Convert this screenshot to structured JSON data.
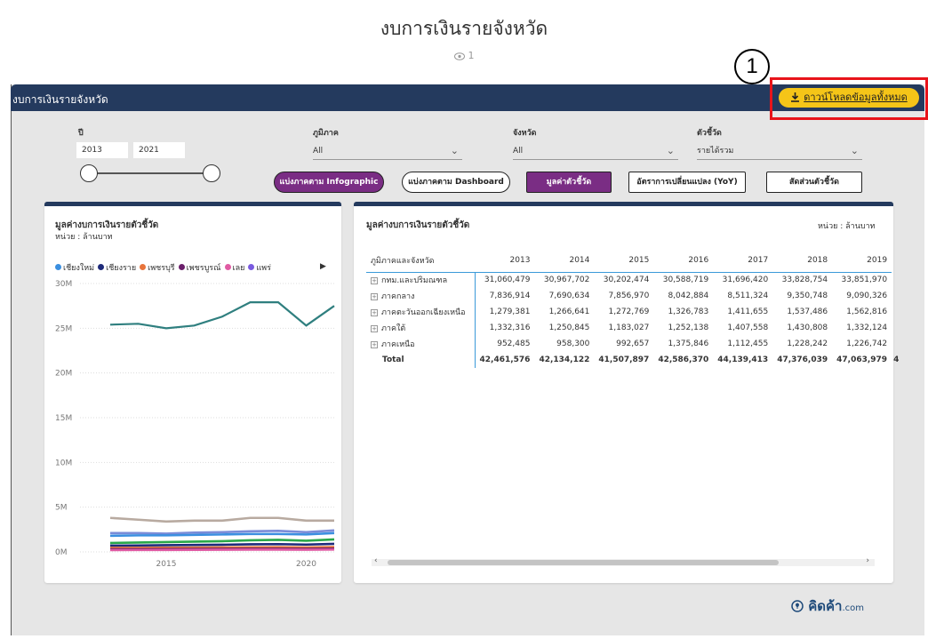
{
  "page": {
    "title": "งบการเงินรายจังหวัด",
    "views": "1"
  },
  "panel": {
    "title": "งบการเงินรายจังหวัด",
    "download_label": "ดาวน์โหลดข้อมูลทั้งหมด",
    "marker": "1"
  },
  "filters": {
    "year_label": "ปี",
    "year_from": "2013",
    "year_to": "2021",
    "region_label": "ภูมิภาค",
    "region_value": "All",
    "province_label": "จังหวัด",
    "province_value": "All",
    "indicator_label": "ตัวชี้วัด",
    "indicator_value": "รายได้รวม"
  },
  "buttons": {
    "infographic": "แบ่งภาคตาม Infographic",
    "dashboard": "แบ่งภาคตาม Dashboard",
    "indicator_value": "มูลค่าตัวชี้วัด",
    "yoy": "อัตราการเปลี่ยนแปลง (YoY)",
    "share": "สัดส่วนตัวชี้วัด"
  },
  "left_card": {
    "title": "มูลค่างบการเงินรายตัวชี้วัด",
    "unit": "หน่วย : ล้านบาท",
    "legend": [
      {
        "name": "เชียงใหม่",
        "color": "#3b8fe0"
      },
      {
        "name": "เชียงราย",
        "color": "#1e2a7a"
      },
      {
        "name": "เพชรบุรี",
        "color": "#e8743b"
      },
      {
        "name": "เพชรบูรณ์",
        "color": "#6b1f6b"
      },
      {
        "name": "เลย",
        "color": "#e05ba3"
      },
      {
        "name": "แพร่",
        "color": "#7a5be0"
      }
    ]
  },
  "right_card": {
    "title": "มูลค่างบการเงินรายตัวชี้วัด",
    "unit": "หน่วย : ล้านบาท",
    "row_header": "ภูมิภาคและจังหวัด",
    "years": [
      "2013",
      "2014",
      "2015",
      "2016",
      "2017",
      "2018",
      "2019"
    ],
    "rows": [
      {
        "label": "กทม.และปริมณฑล",
        "values": [
          "31,060,479",
          "30,967,702",
          "30,202,474",
          "30,588,719",
          "31,696,420",
          "33,828,754",
          "33,851,970"
        ]
      },
      {
        "label": "ภาคกลาง",
        "values": [
          "7,836,914",
          "7,690,634",
          "7,856,970",
          "8,042,884",
          "8,511,324",
          "9,350,748",
          "9,090,326"
        ]
      },
      {
        "label": "ภาคตะวันออกเฉียงเหนือ",
        "values": [
          "1,279,381",
          "1,266,641",
          "1,272,769",
          "1,326,783",
          "1,411,655",
          "1,537,486",
          "1,562,816"
        ]
      },
      {
        "label": "ภาคใต้",
        "values": [
          "1,332,316",
          "1,250,845",
          "1,183,027",
          "1,252,138",
          "1,407,558",
          "1,430,808",
          "1,332,124"
        ]
      },
      {
        "label": "ภาคเหนือ",
        "values": [
          "952,485",
          "958,300",
          "992,657",
          "1,375,846",
          "1,112,455",
          "1,228,242",
          "1,226,742"
        ]
      }
    ],
    "total": {
      "label": "Total",
      "values": [
        "42,461,576",
        "42,134,122",
        "41,507,897",
        "42,586,370",
        "44,139,413",
        "47,376,039",
        "47,063,979"
      ],
      "overflow": "4"
    }
  },
  "chart_data": {
    "type": "line",
    "x": [
      2013,
      2014,
      2015,
      2016,
      2017,
      2018,
      2019,
      2020,
      2021
    ],
    "xticks": [
      "2015",
      "2020"
    ],
    "yticks": [
      "30M",
      "25M",
      "20M",
      "15M",
      "10M",
      "5M",
      "0M"
    ],
    "ylim": [
      0,
      30000000
    ],
    "xlim": [
      2013,
      2021
    ],
    "series": [
      {
        "color": "#2f7f7f",
        "values": [
          25400000,
          25500000,
          25000000,
          25300000,
          26300000,
          27900000,
          27900000,
          25300000,
          27500000
        ]
      },
      {
        "color": "#b8aaa0",
        "values": [
          3800000,
          3600000,
          3400000,
          3500000,
          3500000,
          3800000,
          3800000,
          3500000,
          3500000
        ]
      },
      {
        "color": "#7a8cd8",
        "values": [
          2100000,
          2100000,
          2050000,
          2150000,
          2200000,
          2300000,
          2350000,
          2200000,
          2400000
        ]
      },
      {
        "color": "#3b8fe0",
        "values": [
          1800000,
          1850000,
          1850000,
          1900000,
          1950000,
          2000000,
          2000000,
          1950000,
          2100000
        ]
      },
      {
        "color": "#2aa84a",
        "values": [
          1000000,
          1050000,
          1100000,
          1150000,
          1200000,
          1300000,
          1350000,
          1250000,
          1400000
        ]
      },
      {
        "color": "#1e2a7a",
        "values": [
          700000,
          720000,
          750000,
          780000,
          800000,
          850000,
          870000,
          820000,
          900000
        ]
      },
      {
        "color": "#e8743b",
        "values": [
          450000,
          460000,
          470000,
          480000,
          500000,
          520000,
          530000,
          510000,
          540000
        ]
      },
      {
        "color": "#6b1f6b",
        "values": [
          300000,
          310000,
          320000,
          330000,
          340000,
          350000,
          360000,
          340000,
          370000
        ]
      },
      {
        "color": "#e05ba3",
        "values": [
          200000,
          210000,
          220000,
          230000,
          240000,
          250000,
          255000,
          245000,
          260000
        ]
      }
    ]
  },
  "brand": {
    "name": "คิดค้า",
    "suffix": ".com"
  },
  "colors": {
    "header": "#243a5e",
    "accent_purple": "#7a2d84",
    "download": "#f5c518",
    "highlight": "#e8141a"
  }
}
